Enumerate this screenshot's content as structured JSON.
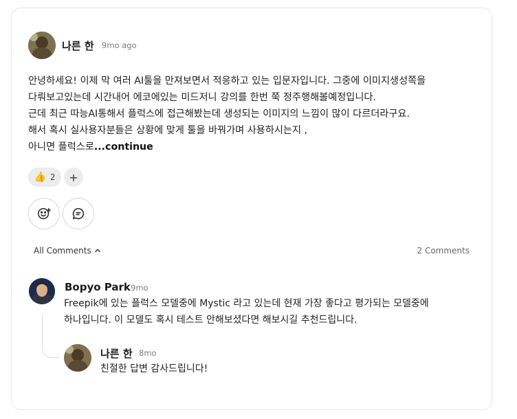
{
  "post": {
    "author": "나른 한",
    "time": "9mo ago",
    "lines": [
      "안녕하세요! 이제 막 여러 AI툴을 만져보면서 적응하고 있는 입문자입니다. 그중에 이미지생성쪽을",
      "다뤄보고있는데 시간내어 에코에있는 미드저니 강의를 한번 쭉 정주행해볼예정입니다.",
      "근데 최근 따능AI통해서 플럭스에 접근해봤는데 생성되는 이미지의 느낌이 많이 다르더라구요.",
      "해서 혹시 실사용자분들은 상황에 맞게 툴을 바꿔가며 사용하시는지 ,",
      "아니면 플럭스로"
    ],
    "continue_label": "...continue",
    "reaction_emoji": "👍",
    "reaction_count": "2",
    "add_reaction_label": "+"
  },
  "comments_header": {
    "all_label": "All Comments",
    "count_label": "2 Comments"
  },
  "comments": [
    {
      "author": "Bopyo Park",
      "time": "9mo",
      "lines": [
        "Freepik에 있는 플럭스 모델중에 Mystic 라고 있는데 현재 가장 좋다고 평가되는 모델중에",
        "하나입니다. 이 모델도 혹시 테스트 안해보셨다면 해보시길 추천드립니다."
      ]
    },
    {
      "author": "나른 한",
      "time": "8mo",
      "lines": [
        "친절한 답변 감사드립니다!"
      ]
    }
  ],
  "icons": {
    "reaction_button": "add-emoji-icon",
    "comment_button": "comment-icon",
    "chevron": "chevron-up-icon"
  }
}
